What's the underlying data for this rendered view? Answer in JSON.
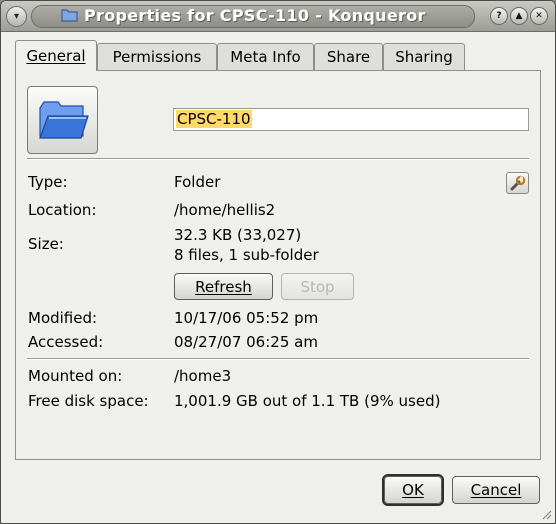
{
  "window": {
    "title": "Properties for CPSC-110 - Konqueror",
    "menu_glyph": "▾",
    "buttons": {
      "help": "?",
      "minimize": "▲",
      "close": "✕"
    }
  },
  "tabs": [
    {
      "label": "General",
      "active": true
    },
    {
      "label": "Permissions",
      "active": false
    },
    {
      "label": "Meta Info",
      "active": false
    },
    {
      "label": "Share",
      "active": false
    },
    {
      "label": "Sharing",
      "active": false
    }
  ],
  "general": {
    "name_value": "CPSC-110",
    "type_label": "Type:",
    "type_value": "Folder",
    "location_label": "Location:",
    "location_value": "/home/hellis2",
    "size_label": "Size:",
    "size_value": "32.3 KB (33,027)",
    "size_detail": "8 files, 1 sub-folder",
    "refresh_label": "Refresh",
    "stop_label": "Stop",
    "modified_label": "Modified:",
    "modified_value": "10/17/06 05:52 pm",
    "accessed_label": "Accessed:",
    "accessed_value": "08/27/07 06:25 am",
    "mounted_label": "Mounted on:",
    "mounted_value": "/home3",
    "free_label": "Free disk space:",
    "free_value": "1,001.9 GB out of 1.1 TB (9% used)"
  },
  "footer": {
    "ok_label": "OK",
    "cancel_label": "Cancel"
  },
  "colors": {
    "folder_blue": "#3a74d8",
    "selection": "#ffd96b",
    "window_bg": "#efefeb"
  }
}
